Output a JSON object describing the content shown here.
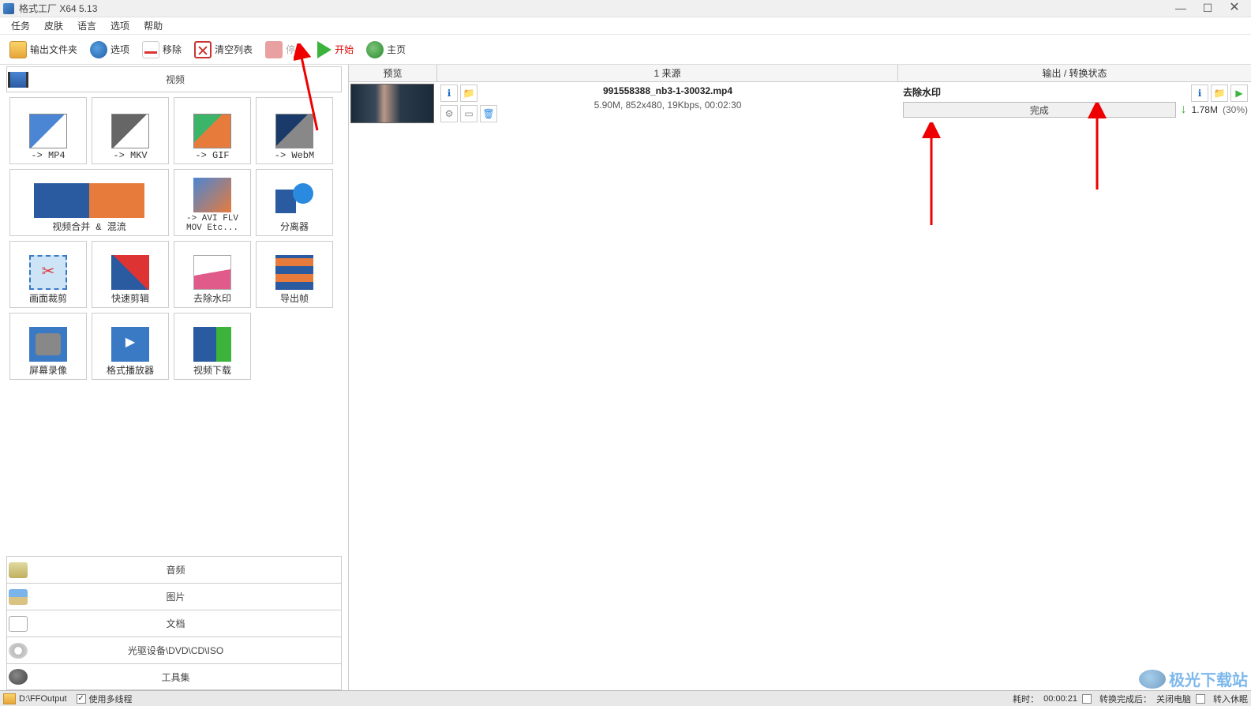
{
  "title": "格式工厂 X64 5.13",
  "menu": {
    "task": "任务",
    "skin": "皮肤",
    "language": "语言",
    "options": "选项",
    "help": "帮助"
  },
  "toolbar": {
    "output_folder": "输出文件夹",
    "options": "选项",
    "remove": "移除",
    "clear_list": "清空列表",
    "stop": "停止",
    "start": "开始",
    "homepage": "主页"
  },
  "sidebar": {
    "video_section": "视频",
    "tiles": {
      "mp4": "-> MP4",
      "mkv": "-> MKV",
      "gif": "-> GIF",
      "webm": "-> WebM",
      "merge": "视频合并 & 混流",
      "avi": "-> AVI FLV MOV Etc...",
      "split": "分离器",
      "crop": "画面裁剪",
      "quick": "快速剪辑",
      "watermark": "去除水印",
      "frames": "导出帧",
      "record": "屏幕录像",
      "player": "格式播放器",
      "download": "视频下载"
    },
    "bottom": {
      "audio": "音频",
      "picture": "图片",
      "document": "文档",
      "disc": "光驱设备\\DVD\\CD\\ISO",
      "tools": "工具集"
    }
  },
  "columns": {
    "preview": "预览",
    "source": "1 来源",
    "status": "输出 / 转换状态"
  },
  "task": {
    "file": "991558388_nb3-1-30032.mp4",
    "info": "5.90M, 852x480, 19Kbps, 00:02:30",
    "op": "去除水印",
    "state": "完成",
    "out_size": "1.78M",
    "pct": "(30%)"
  },
  "statusbar": {
    "path": "D:\\FFOutput",
    "multithread": "使用多线程",
    "elapsed_label": "耗时：",
    "elapsed": "00:00:21",
    "after_label": "转换完成后：",
    "shutdown": "关闭电脑",
    "sleep": "转入休眠"
  },
  "watermark_text": "极光下载站",
  "win": {
    "min": "—",
    "max": "☐",
    "close": "✕"
  }
}
